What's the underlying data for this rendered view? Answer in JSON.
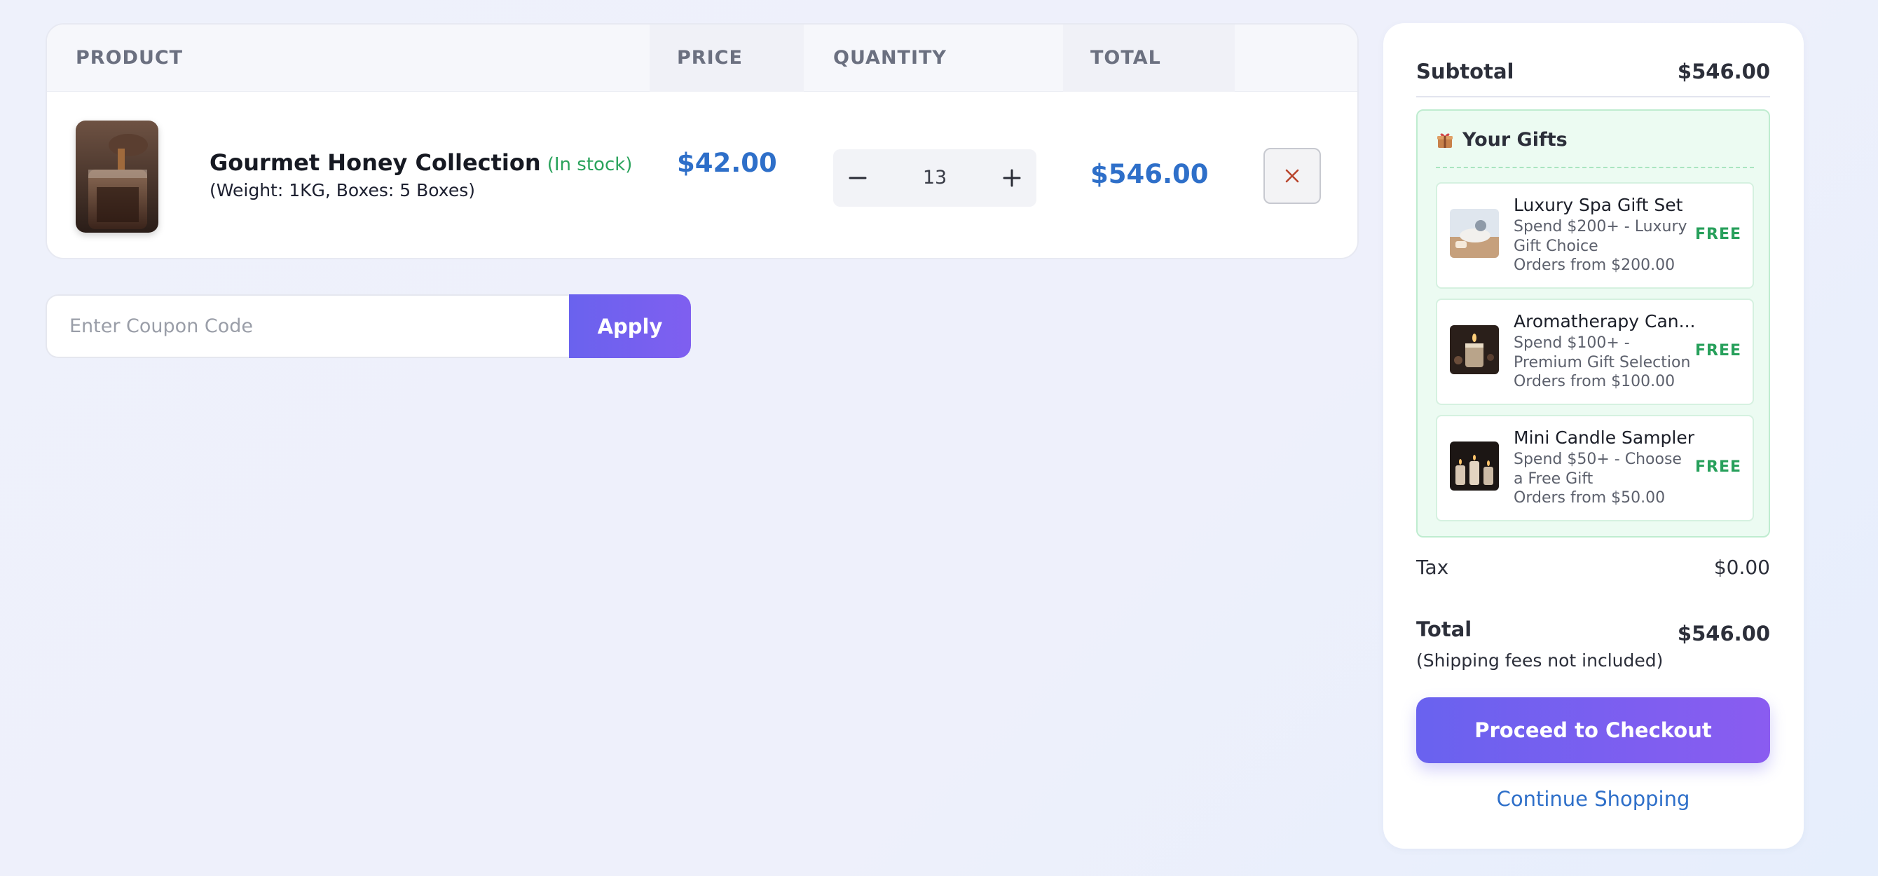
{
  "cart": {
    "headers": {
      "product": "PRODUCT",
      "price": "PRICE",
      "quantity": "QUANTITY",
      "total": "TOTAL"
    },
    "item": {
      "name": "Gourmet Honey Collection",
      "stock": "(In stock)",
      "variant": "(Weight: 1KG, Boxes: 5 Boxes)",
      "price": "$42.00",
      "quantity": "13",
      "total": "$546.00"
    }
  },
  "coupon": {
    "placeholder": "Enter Coupon Code",
    "apply_label": "Apply"
  },
  "summary": {
    "subtotal_label": "Subtotal",
    "subtotal_value": "$546.00",
    "gifts_title": "Your Gifts",
    "gifts": [
      {
        "title": "Luxury Spa Gift Set",
        "description": "Spend $200+ - Luxury Gift Choice",
        "min": "Orders from $200.00",
        "badge": "FREE"
      },
      {
        "title": "Aromatherapy Can...",
        "description": "Spend $100+ - Premium Gift Selection",
        "min": "Orders from $100.00",
        "badge": "FREE"
      },
      {
        "title": "Mini Candle Sampler",
        "description": "Spend $50+ - Choose a Free Gift",
        "min": "Orders from $50.00",
        "badge": "FREE"
      }
    ],
    "tax_label": "Tax",
    "tax_value": "$0.00",
    "total_label": "Total",
    "total_value": "$546.00",
    "shipping_note": "(Shipping fees not included)",
    "checkout_label": "Proceed to Checkout",
    "continue_label": "Continue Shopping"
  },
  "colors": {
    "accent_blue": "#2e6fc9",
    "button_purple": "#6a62ee",
    "in_stock_green": "#2aa35c",
    "gift_bg": "#ecfbf2"
  },
  "icons": {
    "minus": "minus-icon",
    "plus": "plus-icon",
    "remove": "close-icon",
    "gift": "gift-icon"
  }
}
